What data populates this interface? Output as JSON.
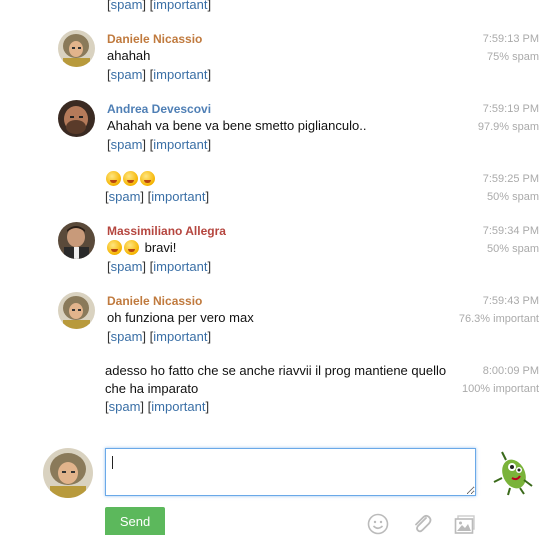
{
  "links": {
    "spam": "spam",
    "important": "important"
  },
  "messages": [
    {
      "author": "",
      "text": "",
      "time": "",
      "score": ""
    },
    {
      "author": "Daniele Nicassio",
      "author_color": "#c07a3e",
      "text": "ahahah",
      "time": "7:59:13 PM",
      "score": "75% spam"
    },
    {
      "author": "Andrea Devescovi",
      "author_color": "#4f7fb5",
      "text": "Ahahah va bene va bene smetto piglianculo..",
      "time": "7:59:19 PM",
      "score": "97.9% spam"
    },
    {
      "author": "",
      "text": "",
      "emoji": [
        "tongue-wink-emoji",
        "tongue-wink-emoji",
        "tongue-wink-emoji"
      ],
      "time": "7:59:25 PM",
      "score": "50% spam"
    },
    {
      "author": "Massimiliano Allegra",
      "author_color": "#b5463f",
      "text": "bravi!",
      "emoji": [
        "wink-emoji",
        "wink-emoji"
      ],
      "time": "7:59:34 PM",
      "score": "50% spam"
    },
    {
      "author": "Daniele Nicassio",
      "author_color": "#c07a3e",
      "text": "oh funziona per vero max",
      "time": "7:59:43 PM",
      "score": "76.3% important"
    },
    {
      "author": "",
      "text_line1": "adesso ho fatto che se anche riavvii il prog mantiene quello",
      "text_line2": "che ha imparato",
      "time": "8:00:09 PM",
      "score": "100% important"
    }
  ],
  "composer": {
    "input_value": "",
    "send_label": "Send"
  },
  "icons": [
    "smiley-icon",
    "paperclip-icon",
    "image-icon"
  ],
  "colors": {
    "send": "#5cb85c",
    "link": "#3a6fa6",
    "input_border": "#6aa9e8"
  }
}
